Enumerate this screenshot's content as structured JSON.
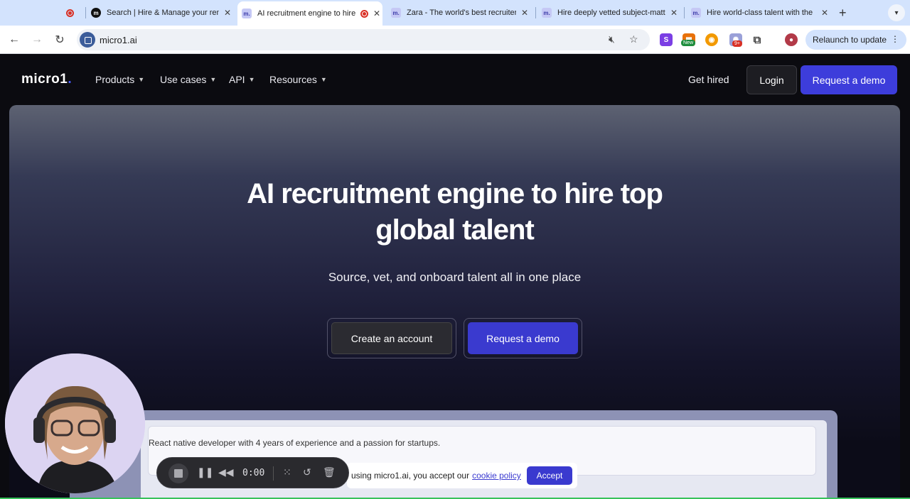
{
  "browser": {
    "tabs": [
      {
        "title": "",
        "recording": true,
        "favicon": ""
      },
      {
        "title": "Search | Hire & Manage your remote",
        "favicon": "m"
      },
      {
        "title": "AI recruitment engine to hire",
        "favicon": "m.",
        "recording": true,
        "active": true
      },
      {
        "title": "Zara - The world's best recruiter",
        "favicon": "m."
      },
      {
        "title": "Hire deeply vetted subject-matter",
        "favicon": "m."
      },
      {
        "title": "Hire world-class talent with the",
        "favicon": "m."
      }
    ],
    "new_tab_glyph": "+",
    "url": "micro1.ai",
    "relaunch_label": "Relaunch to update",
    "ext_badge_new": "New",
    "ext_badge_count": "9+",
    "ext_s_label": "S"
  },
  "site": {
    "logo_text": "micro1",
    "logo_dot": ".",
    "nav": [
      {
        "label": "Products"
      },
      {
        "label": "Use cases"
      },
      {
        "label": "API"
      },
      {
        "label": "Resources"
      }
    ],
    "get_hired": "Get hired",
    "login": "Login",
    "request_demo": "Request a demo"
  },
  "hero": {
    "title_line1": "AI recruitment engine to hire top",
    "title_line2": "global talent",
    "subtitle": "Source, vet, and onboard talent all in one place",
    "cta_create": "Create an account",
    "cta_demo": "Request a demo",
    "prompt_text": "React native developer with 4 years of experience and a passion for startups."
  },
  "cookie": {
    "text": "using micro1.ai, you accept our",
    "link": "cookie policy",
    "accept": "Accept"
  },
  "recorder": {
    "time": "0:00"
  },
  "colors": {
    "brand_blue": "#3d3ddb",
    "tab_strip": "#d3e3fd"
  }
}
